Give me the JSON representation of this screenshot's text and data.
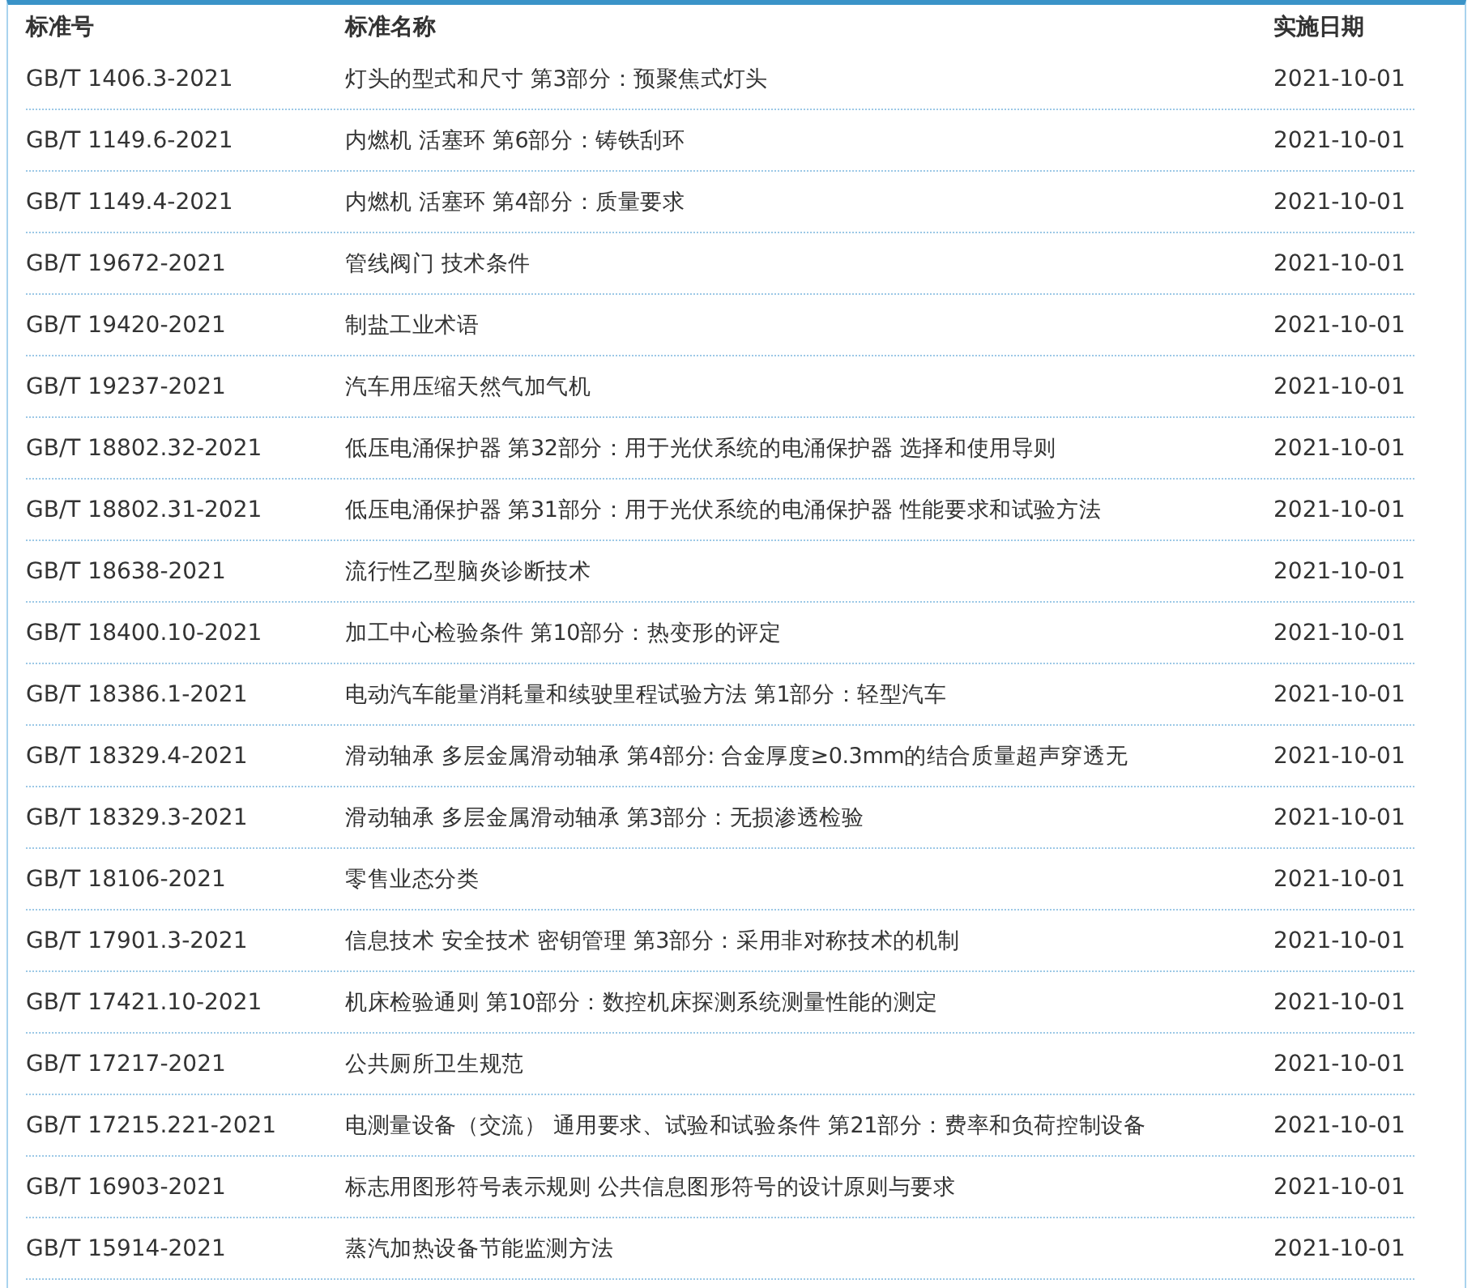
{
  "table": {
    "columns": [
      "标准号",
      "标准名称",
      "实施日期"
    ],
    "rows": [
      {
        "code": "GB/T 1406.3-2021",
        "name": "灯头的型式和尺寸 第3部分：预聚焦式灯头",
        "date": "2021-10-01"
      },
      {
        "code": "GB/T 1149.6-2021",
        "name": "内燃机 活塞环 第6部分：铸铁刮环",
        "date": "2021-10-01"
      },
      {
        "code": "GB/T 1149.4-2021",
        "name": "内燃机 活塞环 第4部分：质量要求",
        "date": "2021-10-01"
      },
      {
        "code": "GB/T 19672-2021",
        "name": "管线阀门 技术条件",
        "date": "2021-10-01"
      },
      {
        "code": "GB/T 19420-2021",
        "name": "制盐工业术语",
        "date": "2021-10-01"
      },
      {
        "code": "GB/T 19237-2021",
        "name": "汽车用压缩天然气加气机",
        "date": "2021-10-01"
      },
      {
        "code": "GB/T 18802.32-2021",
        "name": "低压电涌保护器 第32部分：用于光伏系统的电涌保护器 选择和使用导则",
        "date": "2021-10-01"
      },
      {
        "code": "GB/T 18802.31-2021",
        "name": "低压电涌保护器 第31部分：用于光伏系统的电涌保护器 性能要求和试验方法",
        "date": "2021-10-01"
      },
      {
        "code": "GB/T 18638-2021",
        "name": "流行性乙型脑炎诊断技术",
        "date": "2021-10-01"
      },
      {
        "code": "GB/T 18400.10-2021",
        "name": "加工中心检验条件 第10部分：热变形的评定",
        "date": "2021-10-01"
      },
      {
        "code": "GB/T 18386.1-2021",
        "name": "电动汽车能量消耗量和续驶里程试验方法 第1部分：轻型汽车",
        "date": "2021-10-01"
      },
      {
        "code": "GB/T 18329.4-2021",
        "name": "滑动轴承 多层金属滑动轴承 第4部分: 合金厚度≥0.3mm的结合质量超声穿透无",
        "date": "2021-10-01"
      },
      {
        "code": "GB/T 18329.3-2021",
        "name": "滑动轴承 多层金属滑动轴承 第3部分：无损渗透检验",
        "date": "2021-10-01"
      },
      {
        "code": "GB/T 18106-2021",
        "name": "零售业态分类",
        "date": "2021-10-01"
      },
      {
        "code": "GB/T 17901.3-2021",
        "name": "信息技术 安全技术 密钥管理 第3部分：采用非对称技术的机制",
        "date": "2021-10-01"
      },
      {
        "code": "GB/T 17421.10-2021",
        "name": "机床检验通则 第10部分：数控机床探测系统测量性能的测定",
        "date": "2021-10-01"
      },
      {
        "code": "GB/T 17217-2021",
        "name": "公共厕所卫生规范",
        "date": "2021-10-01"
      },
      {
        "code": "GB/T 17215.221-2021",
        "name": "电测量设备（交流） 通用要求、试验和试验条件 第21部分：费率和负荷控制设备",
        "date": "2021-10-01"
      },
      {
        "code": "GB/T 16903-2021",
        "name": "标志用图形符号表示规则 公共信息图形符号的设计原则与要求",
        "date": "2021-10-01"
      },
      {
        "code": "GB/T 15914-2021",
        "name": "蒸汽加热设备节能监测方法",
        "date": "2021-10-01"
      }
    ]
  }
}
